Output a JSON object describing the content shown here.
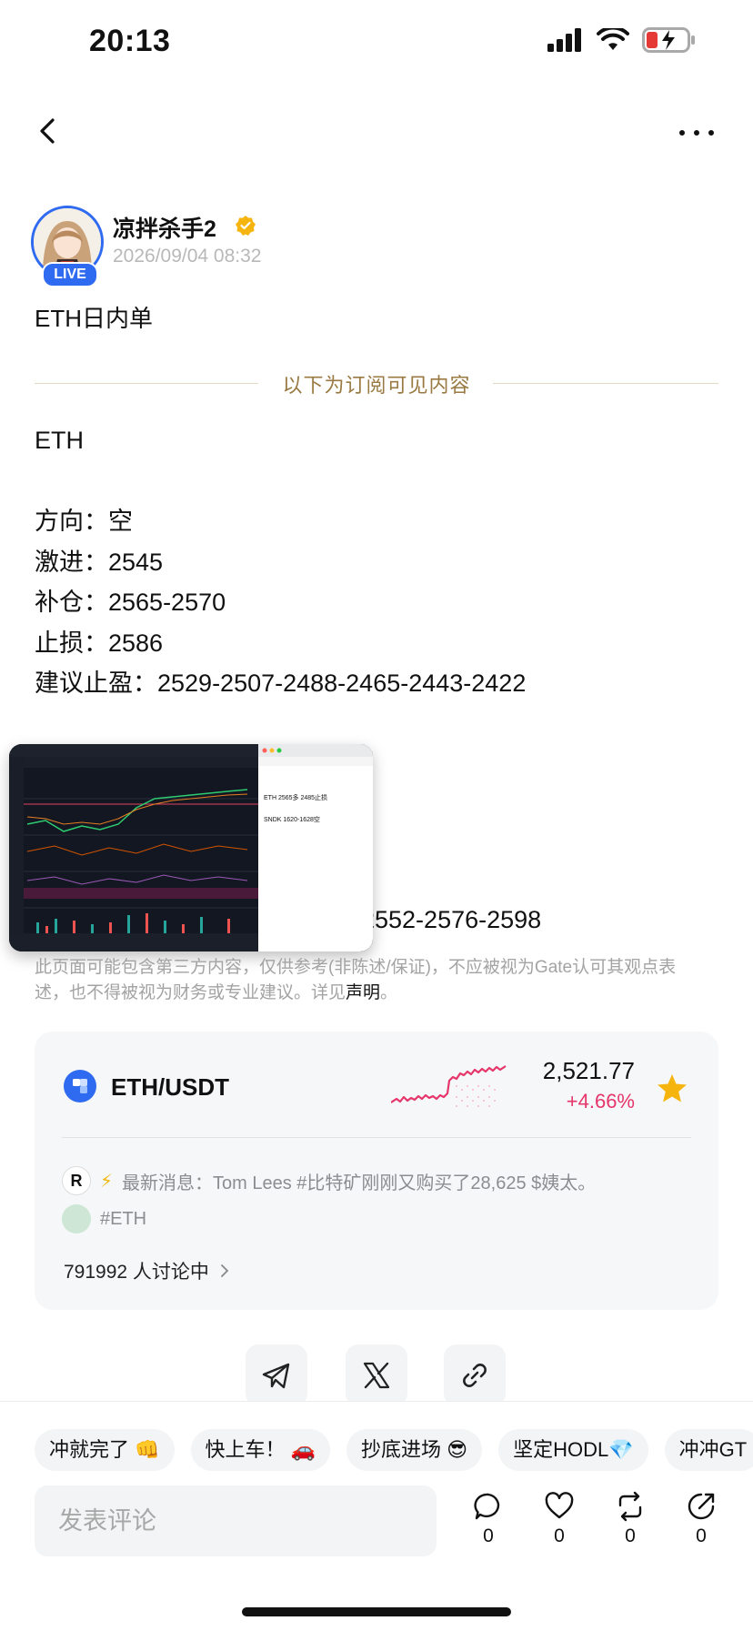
{
  "status_bar": {
    "time": "20:13"
  },
  "author": {
    "name": "凉拌杀手2",
    "date": "2026/09/04 08:32",
    "live_label": "LIVE"
  },
  "post": {
    "title": "ETH日内单",
    "subscriber_divider": "以下为订阅可见内容",
    "lines": [
      "ETH",
      "",
      "方向：空",
      "激进：2545",
      "补仓：2565-2570",
      "止损：2586",
      "建议止盈：2529-2507-2488-2465-2443-2422"
    ],
    "overflow_line": "-2552-2576-2598",
    "thumbnail": {
      "note_line_1": "ETH 2565多 2485止损",
      "note_line_2": "SNDK 1620-1628空"
    }
  },
  "disclaimer": {
    "text": "此页面可能包含第三方内容，仅供参考(非陈述/保证)，不应被视为Gate认可其观点表述，也不得被视为财务或专业建议。详见",
    "link": "声明",
    "end": "。"
  },
  "market_card": {
    "pair": "ETH/USDT",
    "price": "2,521.77",
    "change": "+4.66%",
    "news_logo": "R",
    "news": "最新消息：Tom Lees #比特矿刚刚又购买了28,625 $姨太。",
    "tag": "#ETH",
    "discussion": "791992 人讨论中"
  },
  "quick_replies": [
    "冲就完了 👊",
    "快上车！ 🚗",
    "抄底进场 😎",
    "坚定HODL💎",
    "冲冲GT"
  ],
  "comment": {
    "placeholder": "发表评论",
    "counts": {
      "comments": "0",
      "likes": "0",
      "reposts": "0",
      "shares": "0"
    }
  },
  "colors": {
    "accent": "#2f6bf0",
    "up": "#e5356b",
    "gold": "#9a7a43",
    "star": "#f6b50e"
  }
}
